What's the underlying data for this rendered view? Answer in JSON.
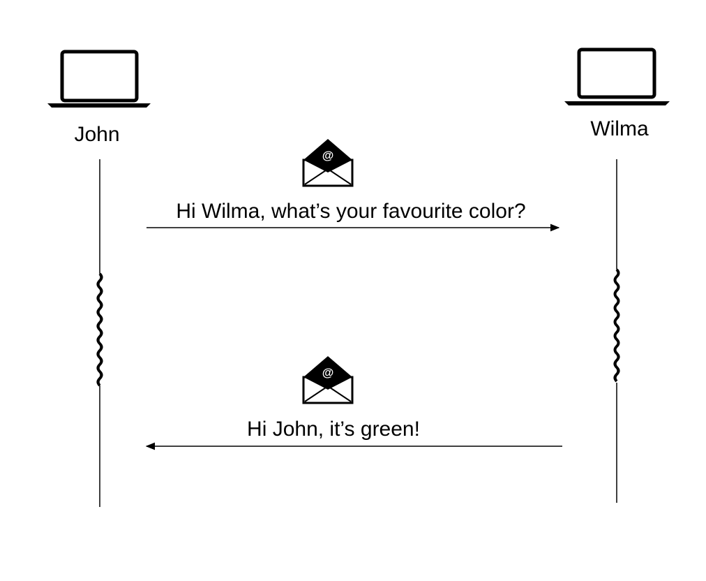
{
  "actors": {
    "left": {
      "name": "John",
      "icon": "laptop-icon"
    },
    "right": {
      "name": "Wilma",
      "icon": "laptop-icon"
    }
  },
  "messages": [
    {
      "from": "John",
      "to": "Wilma",
      "text": "Hi Wilma, what’s your favourite color?",
      "icon": "email-icon"
    },
    {
      "from": "Wilma",
      "to": "John",
      "text": "Hi John, it’s green!",
      "icon": "email-icon"
    }
  ],
  "colors": {
    "ink": "#000000",
    "background": "#ffffff"
  }
}
